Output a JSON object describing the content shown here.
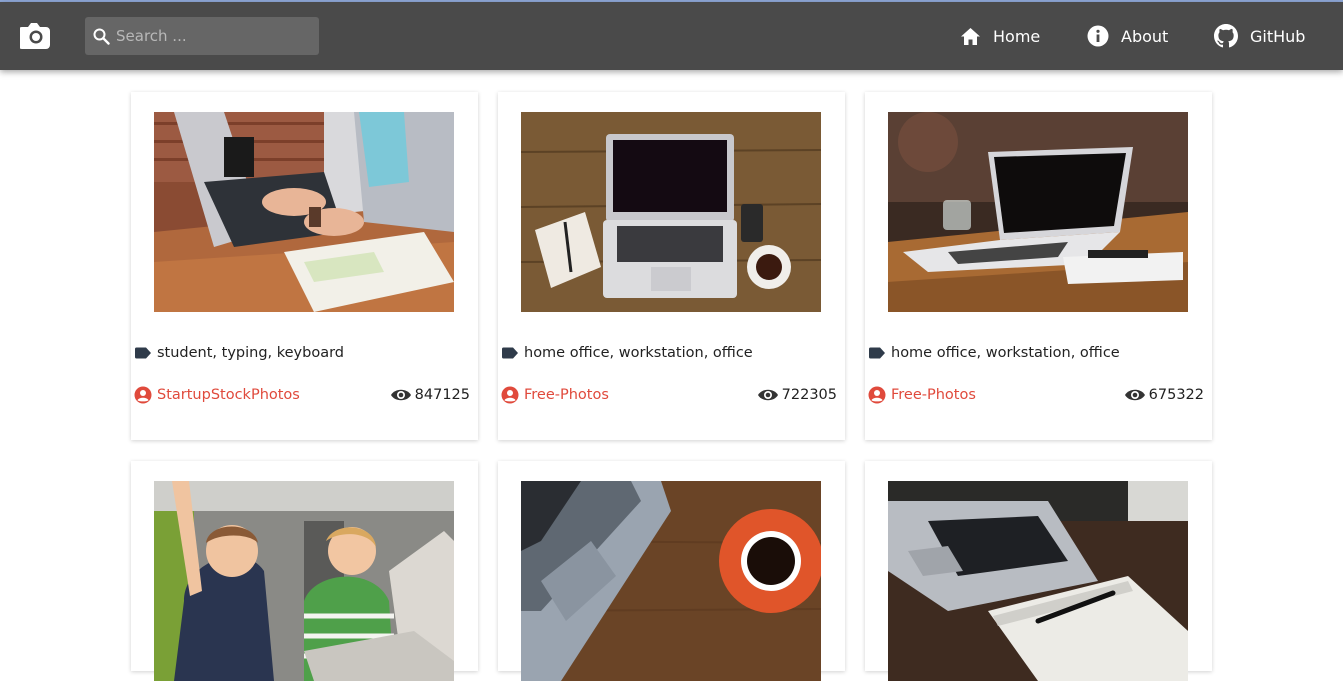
{
  "nav": {
    "logo_icon": "camera-icon",
    "search_placeholder": "Search ...",
    "home_label": "Home",
    "about_label": "About",
    "github_label": "GitHub"
  },
  "colors": {
    "navbar": "#4a4a4a",
    "accent_user": "#e04a3c"
  },
  "cards": [
    {
      "tags": "student, typing, keyboard",
      "user": "StartupStockPhotos",
      "views": "847125",
      "image": "person-typing-on-laptop"
    },
    {
      "tags": "home office, workstation, office",
      "user": "Free-Photos",
      "views": "722305",
      "image": "laptop-notebook-coffee-on-wood"
    },
    {
      "tags": "home office, workstation, office",
      "user": "Free-Photos",
      "views": "675322",
      "image": "laptop-on-table-with-glass"
    },
    {
      "image": "kids-cheering-at-laptop"
    },
    {
      "image": "laptop-with-orange-coffee-cup"
    },
    {
      "image": "laptop-with-notebook-and-pen"
    }
  ]
}
